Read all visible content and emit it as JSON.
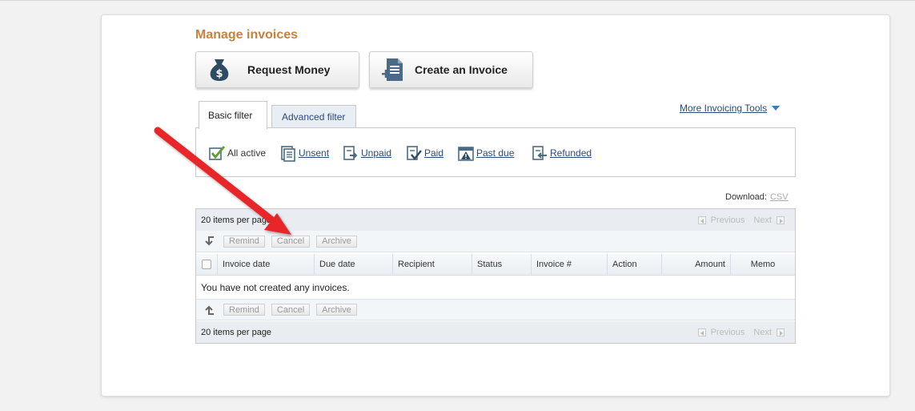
{
  "page": {
    "title": "Manage invoices"
  },
  "buttons": {
    "request_money": "Request Money",
    "create_invoice": "Create an Invoice"
  },
  "tabs": {
    "basic": "Basic filter",
    "advanced": "Advanced filter"
  },
  "more_tools": "More Invoicing Tools",
  "filters": [
    {
      "label": "All active",
      "icon": "check-doc-icon",
      "active": true
    },
    {
      "label": "Unsent",
      "icon": "doc-icon"
    },
    {
      "label": "Unpaid",
      "icon": "doc-arrow-icon"
    },
    {
      "label": "Paid",
      "icon": "doc-check-icon"
    },
    {
      "label": "Past due",
      "icon": "calendar-warning-icon"
    },
    {
      "label": "Refunded",
      "icon": "doc-return-icon"
    }
  ],
  "download": {
    "label": "Download:",
    "csv": "CSV"
  },
  "grid": {
    "items_per_page": "20 items per page",
    "previous": "Previous",
    "next": "Next",
    "actions": {
      "remind": "Remind",
      "cancel": "Cancel",
      "archive": "Archive"
    },
    "columns": [
      "Invoice date",
      "Due date",
      "Recipient",
      "Status",
      "Invoice #",
      "Action",
      "Amount",
      "Memo"
    ],
    "empty_message": "You have not created any invoices."
  },
  "colors": {
    "title": "#c8803d",
    "link": "#2b4a7a",
    "annotation_arrow": "#e8262b"
  }
}
